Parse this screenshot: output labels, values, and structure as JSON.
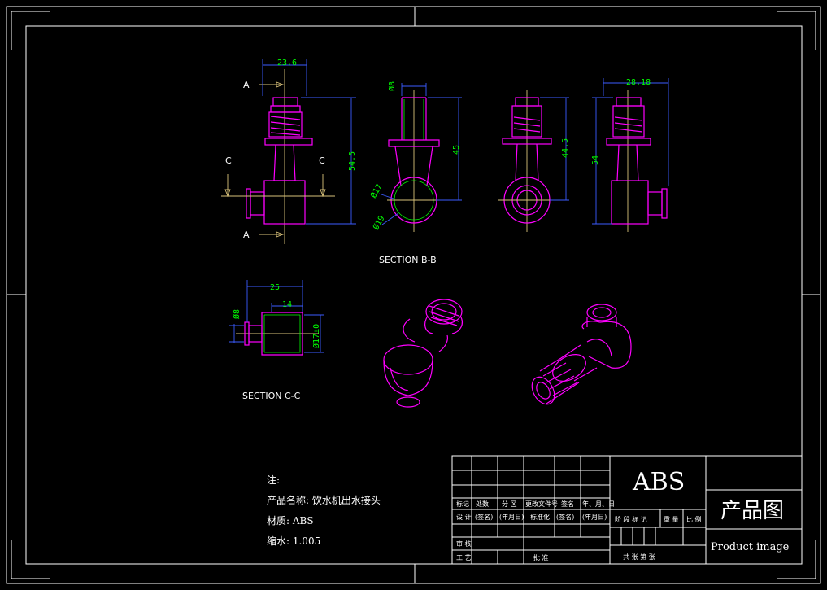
{
  "drawing": {
    "section_labels": {
      "a_top": "A",
      "a_bottom": "A",
      "c_left": "C",
      "c_right": "C",
      "section_bb": "SECTION B-B",
      "section_cc": "SECTION C-C"
    },
    "dimensions": {
      "front_width": "23.6",
      "front_height": "54.5",
      "bb_top": "Ø8",
      "bb_height": "45",
      "bb_d17": "Ø17",
      "bb_d19": "Ø19",
      "side_height": "44.5",
      "right_width": "28.18",
      "right_height": "54",
      "cc_width": "25",
      "cc_inner": "14",
      "cc_left": "Ø8",
      "cc_right": "Ø17±0"
    }
  },
  "notes": {
    "heading": "注:",
    "product_name": "产品名称: 饮水机出水接头",
    "material": "材质: ABS",
    "shrink": "缩水: 1.005"
  },
  "title_block": {
    "row_labels": [
      "标记",
      "处数",
      "分 区",
      "更改文件号",
      "签名",
      "年、月、日"
    ],
    "row2_labels": [
      "设 计",
      "(签名)",
      "(年月日)",
      "标准化",
      "(签名)",
      "(年月日)"
    ],
    "row3_labels": [
      "审 核"
    ],
    "row4_labels": [
      "工 艺",
      "批 准"
    ],
    "stage_labels": [
      "阶 段 标 记",
      "重 量",
      "比 例"
    ],
    "sheet_labels": [
      "共  张  第  张"
    ],
    "material": "ABS",
    "drawing_name": "产品图",
    "drawing_name_en": "Product image"
  },
  "colors": {
    "background": "#000000",
    "frame": "#ffffff",
    "part": "#ff00ff",
    "dimension_line": "#3b5bff",
    "dimension_text": "#00ff00",
    "center_line": "#d9c27a"
  }
}
